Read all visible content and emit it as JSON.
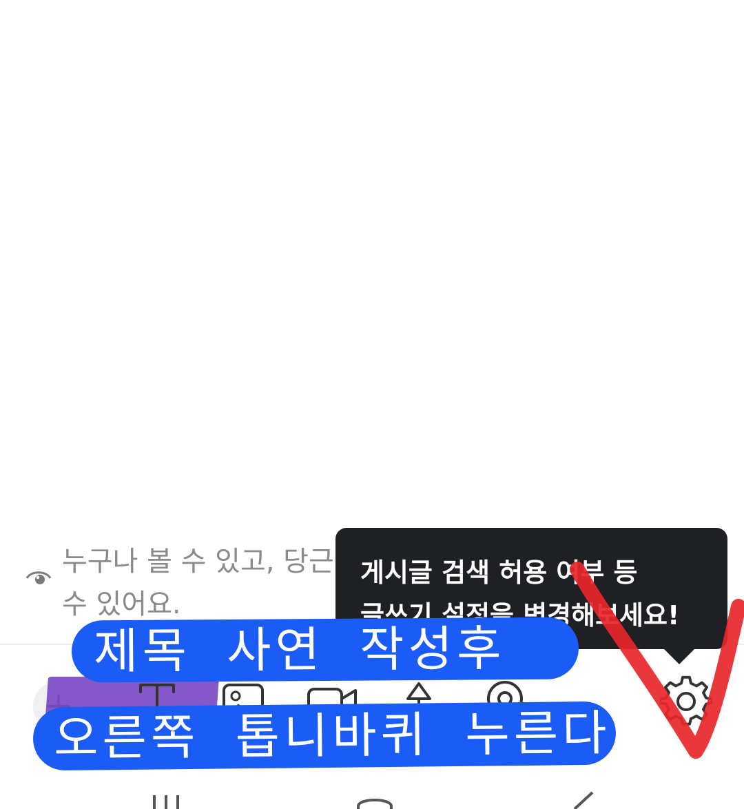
{
  "notice": {
    "line1": "누구나 볼 수 있고, 당근",
    "line2": "수 있어요."
  },
  "tooltip": {
    "line1": "게시글 검색 허용 여부 등",
    "line2": "글쓰기 설정을 변경해보세요!"
  },
  "annotation": {
    "line1": "제목  사연  작성후",
    "line2": "오른쪽  톱니바퀴  누른다"
  },
  "toolbar": {
    "icons": [
      "plus-icon",
      "text-format-icon",
      "image-icon",
      "video-icon",
      "location-pin-icon",
      "map-pin-icon",
      "settings-gear-icon"
    ]
  },
  "colors": {
    "tooltip_bg": "#1f2023",
    "annotation_blue": "#1a5cf5",
    "highlight_purple": "#7b4bc4",
    "check_red": "#e8262b",
    "muted_text": "#8a8a8e"
  }
}
